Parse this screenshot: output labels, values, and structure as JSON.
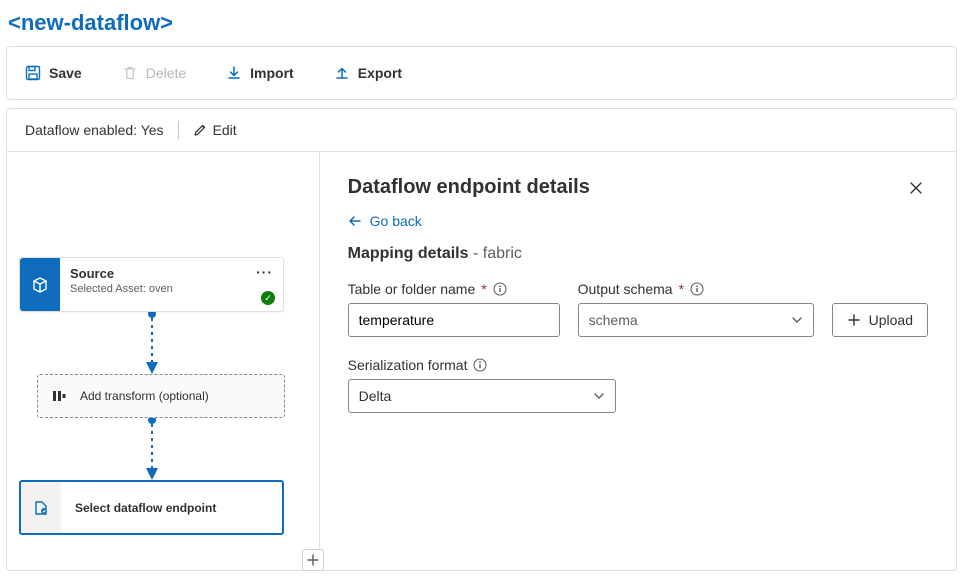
{
  "title": "<new-dataflow>",
  "toolbar": {
    "save": "Save",
    "delete": "Delete",
    "import": "Import",
    "export": "Export"
  },
  "status": {
    "enabled_label": "Dataflow enabled: Yes",
    "edit": "Edit"
  },
  "canvas": {
    "source": {
      "title": "Source",
      "subtitle": "Selected Asset: oven"
    },
    "transform": "Add transform (optional)",
    "endpoint": "Select dataflow endpoint"
  },
  "details": {
    "heading": "Dataflow endpoint details",
    "go_back": "Go back",
    "section_main": "Mapping details",
    "section_sub": " - fabric",
    "table_name_label": "Table or folder name",
    "table_name_value": "temperature",
    "output_schema_label": "Output schema",
    "output_schema_placeholder": "schema",
    "upload_label": "Upload",
    "serialization_label": "Serialization format",
    "serialization_value": "Delta"
  }
}
